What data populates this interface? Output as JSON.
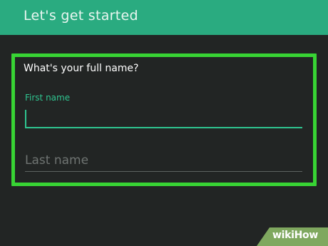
{
  "header": {
    "title": "Let's get started"
  },
  "form": {
    "question": "What's your full name?",
    "first_name": {
      "label": "First name",
      "value": ""
    },
    "last_name": {
      "placeholder": "Last name",
      "value": ""
    }
  },
  "watermark": {
    "text": "wikiHow"
  },
  "colors": {
    "header_bg": "#2aab80",
    "background": "#222524",
    "accent": "#2fc590",
    "highlight": "#38d434"
  }
}
